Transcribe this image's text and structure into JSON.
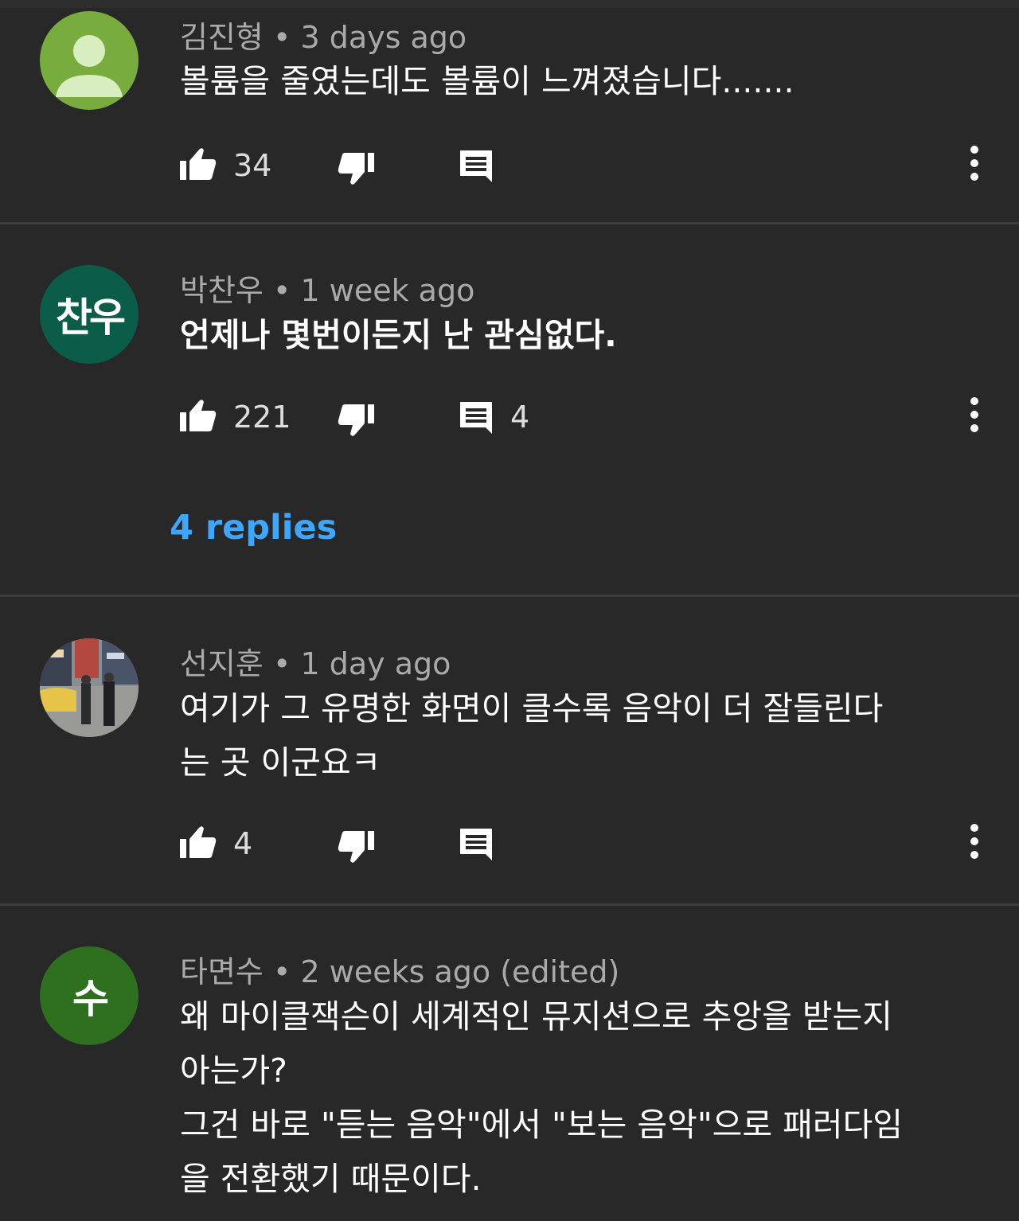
{
  "colors": {
    "background": "#282828",
    "link": "#3ea6ff",
    "meta": "#aaaaaa",
    "divider": "#3d3d3d"
  },
  "comments": [
    {
      "author": "김진형",
      "time": "3 days ago",
      "text_lines": [
        "볼륨을 줄였는데도 볼륨이 느껴졌습니다......."
      ],
      "likes": "34",
      "reply_count": "",
      "avatar": {
        "type": "default-person",
        "color": "#79ac3f"
      }
    },
    {
      "author": "박찬우",
      "time": "1 week ago",
      "text_lines": [
        "언제나 몇번이든지 난 관심없다."
      ],
      "likes": "221",
      "reply_count": "4",
      "replies_label": "4 replies",
      "avatar": {
        "type": "initials",
        "initials": "찬우",
        "color": "#0b5c48"
      }
    },
    {
      "author": "선지훈",
      "time": "1 day ago",
      "text_lines": [
        "여기가 그 유명한 화면이 클수록 음악이 더 잘들린다",
        "는 곳 이군요ㅋ"
      ],
      "likes": "4",
      "reply_count": "",
      "avatar": {
        "type": "photo-street-scene"
      }
    },
    {
      "author": "타면수",
      "time": "2 weeks ago (edited)",
      "text_lines": [
        "왜 마이클잭슨이 세계적인 뮤지션으로 추앙을 받는지",
        "아는가?",
        "그건 바로 \"듣는 음악\"에서 \"보는 음악\"으로 패러다임",
        "을 전환했기 때문이다."
      ],
      "avatar": {
        "type": "initials",
        "initials": "수",
        "color": "#2e7020"
      }
    }
  ]
}
